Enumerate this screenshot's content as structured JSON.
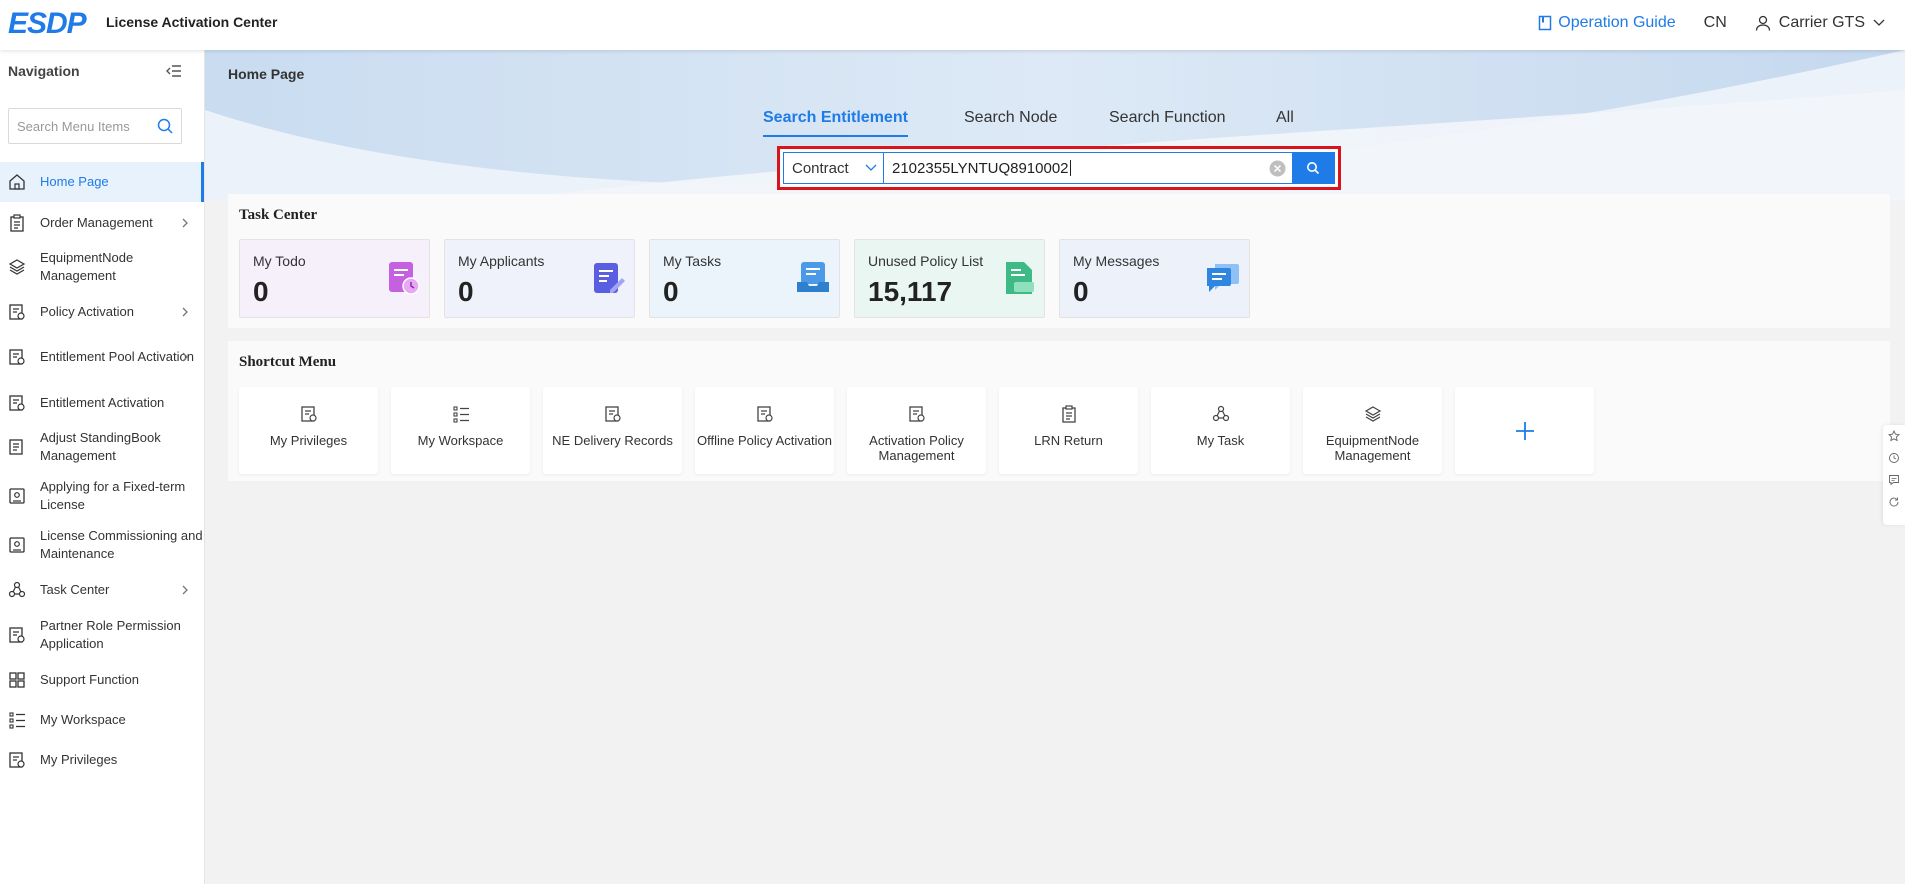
{
  "header": {
    "logo_text": "ESDP",
    "app_title": "License Activation Center",
    "operation_guide": "Operation Guide",
    "language": "CN",
    "user_name": "Carrier GTS"
  },
  "sidebar": {
    "title": "Navigation",
    "search_placeholder": "Search Menu Items",
    "items": [
      {
        "label": "Home Page"
      },
      {
        "label": "Order Management"
      },
      {
        "label": "EquipmentNode Management"
      },
      {
        "label": "Policy Activation"
      },
      {
        "label": "Entitlement Pool Activation"
      },
      {
        "label": "Entitlement Activation"
      },
      {
        "label": "Adjust StandingBook Management"
      },
      {
        "label": "Applying for a Fixed-term License"
      },
      {
        "label": "License Commissioning and Maintenance"
      },
      {
        "label": "Task Center"
      },
      {
        "label": "Partner Role Permission Application"
      },
      {
        "label": "Support Function"
      },
      {
        "label": "My Workspace"
      },
      {
        "label": "My Privileges"
      }
    ]
  },
  "main": {
    "breadcrumb": "Home Page",
    "tabs": [
      {
        "label": "Search Entitlement"
      },
      {
        "label": "Search Node"
      },
      {
        "label": "Search Function"
      },
      {
        "label": "All"
      }
    ],
    "search": {
      "type_selected": "Contract",
      "value": "2102355LYNTUQ8910002"
    }
  },
  "task_center": {
    "title": "Task Center",
    "cards": [
      {
        "label": "My Todo",
        "value": "0",
        "bg": "#f6f0fb"
      },
      {
        "label": "My Applicants",
        "value": "0",
        "bg": "#f0f2fb"
      },
      {
        "label": "My Tasks",
        "value": "0",
        "bg": "#ebf4fb"
      },
      {
        "label": "Unused Policy List",
        "value": "15,117",
        "bg": "#eaf6f2"
      },
      {
        "label": "My Messages",
        "value": "0",
        "bg": "#edf2fa"
      }
    ]
  },
  "shortcut_menu": {
    "title": "Shortcut Menu",
    "items": [
      {
        "label": "My Privileges"
      },
      {
        "label": "My Workspace"
      },
      {
        "label": "NE Delivery Records"
      },
      {
        "label": "Offline Policy Activation"
      },
      {
        "label": "Activation Policy Management"
      },
      {
        "label": "LRN Return"
      },
      {
        "label": "My Task"
      },
      {
        "label": "EquipmentNode Management"
      }
    ]
  },
  "colors": {
    "accent": "#1e7be8",
    "highlight_border": "#d9141b"
  }
}
